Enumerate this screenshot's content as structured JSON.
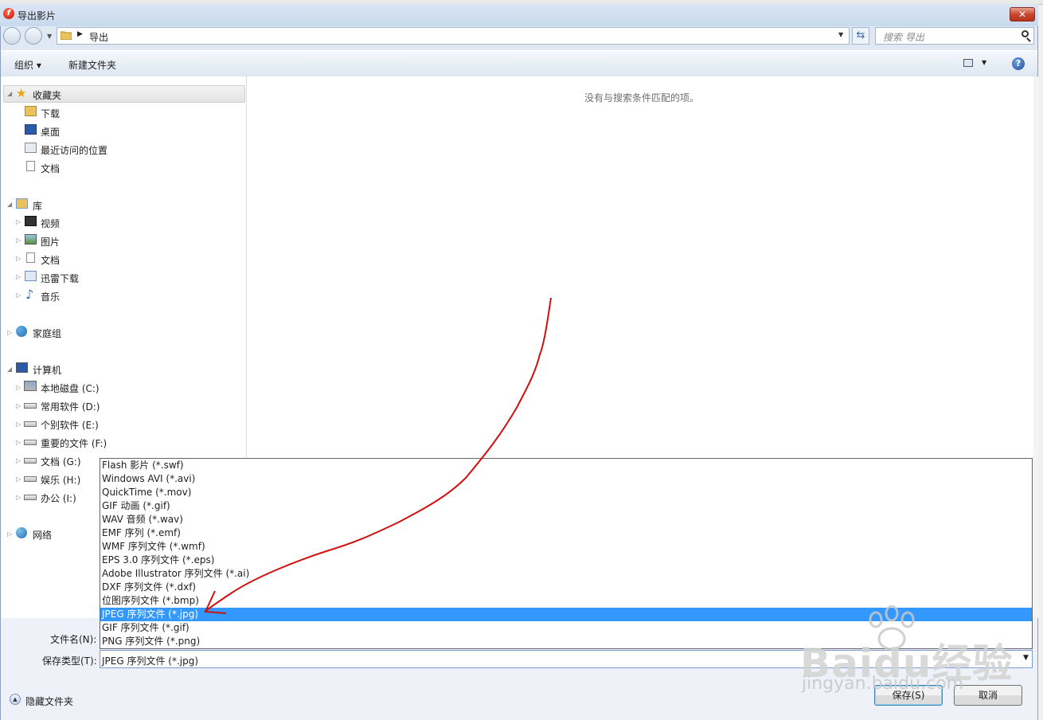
{
  "window": {
    "title": "导出影片",
    "close": "✕"
  },
  "address": {
    "path": "导出",
    "search_placeholder": "搜索 导出"
  },
  "toolbar": {
    "organize": "组织 ▾",
    "new_folder": "新建文件夹"
  },
  "sidebar": {
    "favorites": {
      "label": "收藏夹",
      "items": [
        "下载",
        "桌面",
        "最近访问的位置",
        "文档"
      ]
    },
    "libraries": {
      "label": "库",
      "items": [
        "视频",
        "图片",
        "文档",
        "迅雷下载",
        "音乐"
      ]
    },
    "homegroup": "家庭组",
    "computer": {
      "label": "计算机",
      "items": [
        "本地磁盘 (C:)",
        "常用软件 (D:)",
        "个别软件 (E:)",
        "重要的文件 (F:)",
        "文档 (G:)",
        "娱乐 (H:)",
        "办公 (I:)"
      ]
    },
    "network": "网络"
  },
  "content": {
    "empty_message": "没有与搜索条件匹配的项。"
  },
  "form": {
    "filename_label": "文件名(N):",
    "filetype_label": "保存类型(T):",
    "filetype_value": "JPEG 序列文件 (*.jpg)",
    "filetype_options": [
      "Flash 影片 (*.swf)",
      "Windows AVI (*.avi)",
      "QuickTime (*.mov)",
      "GIF 动画 (*.gif)",
      "WAV 音频 (*.wav)",
      "EMF 序列 (*.emf)",
      "WMF 序列文件 (*.wmf)",
      "EPS 3.0 序列文件 (*.eps)",
      "Adobe Illustrator 序列文件 (*.ai)",
      "DXF 序列文件 (*.dxf)",
      "位图序列文件 (*.bmp)",
      "JPEG 序列文件 (*.jpg)",
      "GIF 序列文件 (*.gif)",
      "PNG 序列文件 (*.png)"
    ],
    "selected_index": 11
  },
  "footer": {
    "hide_folders": "隐藏文件夹",
    "save": "保存(S)",
    "cancel": "取消"
  },
  "watermark": {
    "logo": "Baidu经验",
    "url": "jingyan.baidu.com"
  },
  "colors": {
    "selection": "#3399ff",
    "annotation": "#d01010",
    "close_button": "#c9472e"
  }
}
